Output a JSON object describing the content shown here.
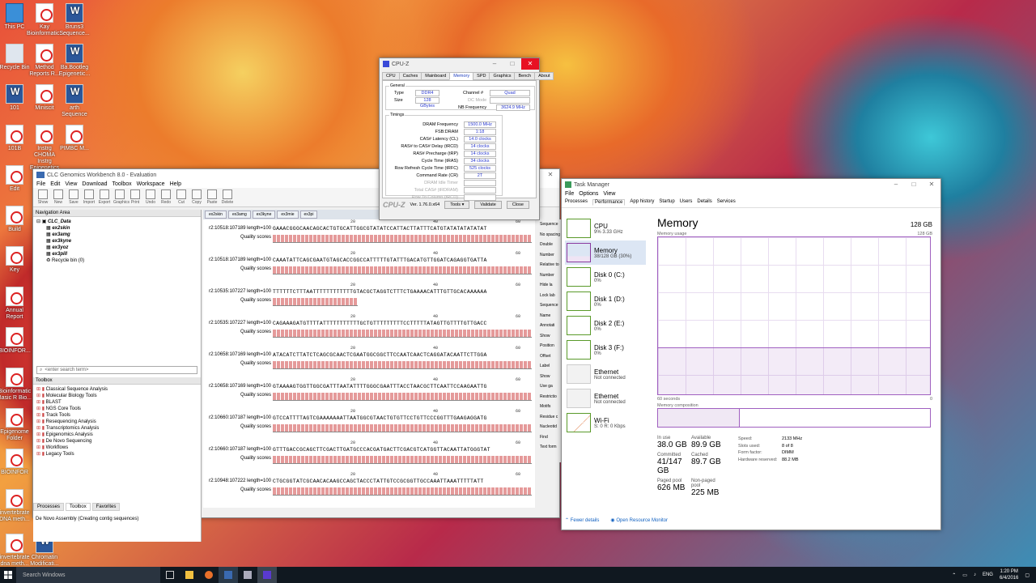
{
  "desktop": {
    "icons": [
      {
        "label": "This PC",
        "type": "pc"
      },
      {
        "label": "Kay Bioinformatic...",
        "type": "pdf"
      },
      {
        "label": "Bruns3 Sequence...",
        "type": "doc"
      },
      {
        "label": "Recycle Bin",
        "type": "bin"
      },
      {
        "label": "Method Reports R...",
        "type": "pdf"
      },
      {
        "label": "Ba.Bootleg Epigenetic...",
        "type": "doc"
      },
      {
        "label": "101",
        "type": "doc"
      },
      {
        "label": "Miniscit",
        "type": "pdf"
      },
      {
        "label": "arth Sequence",
        "type": "doc"
      },
      {
        "label": "101B",
        "type": "pdf"
      },
      {
        "label": "Instrg CHOMA Instrg Epigenetics",
        "type": "pdf"
      },
      {
        "label": "PIMBC M...",
        "type": "pdf"
      },
      {
        "label": "Edit",
        "type": "pdf"
      },
      {
        "label": "Build",
        "type": "pdf"
      },
      {
        "label": "Key",
        "type": "pdf"
      },
      {
        "label": "Annual Report",
        "type": "pdf"
      },
      {
        "label": "BIOINFOR...",
        "type": "pdf"
      },
      {
        "label": "Bioinformatic Basic R Bio...",
        "type": "pdf"
      },
      {
        "label": "Epigenome Folder",
        "type": "pdf"
      },
      {
        "label": "BIOINFOR",
        "type": "pdf"
      },
      {
        "label": "invertebrate DNA meth...",
        "type": "pdf"
      },
      {
        "label": "invertebrate dna meth...",
        "type": "pdf"
      },
      {
        "label": "Chromatin Modificati...",
        "type": "doc"
      }
    ]
  },
  "clc": {
    "title": "CLC Genomics Workbench 8.0 - Evaluation",
    "menu": [
      "File",
      "Edit",
      "View",
      "Download",
      "Toolbox",
      "Workspace",
      "Help"
    ],
    "toolbar": [
      "Show",
      "New",
      "Save",
      "Import",
      "Export",
      "Graphics",
      "Print",
      "Undo",
      "Redo",
      "Cut",
      "Copy",
      "Paste",
      "Delete"
    ],
    "nav_header": "Navigation Area",
    "tree_root": "CLC_Data",
    "tree_items": [
      "ex2skin",
      "ex3amg",
      "ex3kyne",
      "ex3yoz",
      "ex3pill"
    ],
    "tree_recycle": "Recycle bin (0)",
    "search_placeholder": "<enter search term>",
    "toolbox_header": "Toolbox",
    "toolbox_items": [
      "Classical Sequence Analysis",
      "Molecular Biology Tools",
      "BLAST",
      "NGS Core Tools",
      "Track Tools",
      "Resequencing Analysis",
      "Transcriptomics Analysis",
      "Epigenomics Analysis",
      "De Novo Sequencing",
      "Workflows",
      "Legacy Tools"
    ],
    "bottom_tabs": [
      "Processes",
      "Toolbox",
      "Favorites"
    ],
    "status": "De Novo Assembly (Creating contig sequences)",
    "tabs": [
      "ex2skin",
      "ex3amg",
      "ex3kyne",
      "ex3mie",
      "ex3pi"
    ],
    "ruler": [
      "20",
      "40",
      "60"
    ],
    "quality_label": "Quality scores",
    "reads": [
      {
        "name": "r2:10518:107189 length=100",
        "seq": "GAAACGGGCAACAGCACTGTGCATTGGCGTATATCCATTACTTATTTCATGTATATATATATAT"
      },
      {
        "name": "r2:10518:107189 length=100",
        "seq": "CAAATATTCAGCGAATGTAGCACCGGCCATTTTTGTATTTGACATGTTGGATCAGAGGTGATTA"
      },
      {
        "name": "r2:10535:107227 length=100",
        "seq": "TTTTTTCTTTAATTTTTTTTTTTTGTACGCTAGGTCTTTCTGAAAACATTTGTTGCACAAAAAA"
      },
      {
        "name": "r2:10535:107227 length=100",
        "seq": "CAGAAAGATGTTTTATTTTTTTTTTTGCTGTTTTTTTTTCCTTTTTATAGTTGTTTTGTTGACC"
      },
      {
        "name": "r2:10658:107169 length=100",
        "seq": "ATACATCTTATCTCAGCGCAACTCGAATGGCGGCTTCCAATCAACTCAGGATACAATTCTTGGA"
      },
      {
        "name": "r2:10658:107169 length=100",
        "seq": "GTAAAAGTGGTTGGCGATTTAATATTTTGGGCGAATTTACCTAACGCTTCAATTCCAAGAATTG"
      },
      {
        "name": "r2:10660:107187 length=100",
        "seq": "GTCCATTTTAGTCGAAAAAAATTAATGGCGTAACTGTGTTCCTGTTCCCGGTTTGAAGAGGATG"
      },
      {
        "name": "r2:10660:107187 length=100",
        "seq": "GTTTGACCGCAGCTTCGACTTGATGCCCACGATGACTTCGACGTCATGGTTACAATTATGGGTAT"
      },
      {
        "name": "r2:10948:107222 length=100",
        "seq": "CTGCGGTATCGCAACACAAGCCAGCTACCCTATTGTCCGCGGTTGCCAAATTAAATTTTTATT"
      }
    ],
    "side_items": [
      "Sequence",
      "No spacing",
      "Double",
      "Number",
      "Relative to",
      "Number",
      "Hide la",
      "Lock lab",
      "Sequence",
      "Name",
      "Annotati",
      "Show",
      "Position",
      "Offset",
      "Label",
      "Show",
      "Use ga",
      "Restrictio",
      "Motifs",
      "Residue c",
      "Nucleotid",
      "Find",
      "Text form"
    ]
  },
  "cpuz": {
    "title": "CPU-Z",
    "tabs": [
      "CPU",
      "Caches",
      "Mainboard",
      "Memory",
      "SPD",
      "Graphics",
      "Bench",
      "About"
    ],
    "active_tab": "Memory",
    "general_label": "General",
    "type_label": "Type",
    "type_value": "DDR4",
    "channel_label": "Channel #",
    "channel_value": "Quad",
    "size_label": "Size",
    "size_value": "128 GBytes",
    "dcmode_label": "DC Mode",
    "dcmode_value": "",
    "nb_label": "NB Frequency",
    "nb_value": "3624.9 MHz",
    "timings_label": "Timings",
    "timings": [
      {
        "k": "DRAM Frequency",
        "v": "1500.0 MHz"
      },
      {
        "k": "FSB:DRAM",
        "v": "1:18"
      },
      {
        "k": "CAS# Latency (CL)",
        "v": "14.0 clocks"
      },
      {
        "k": "RAS# to CAS# Delay (tRCD)",
        "v": "14 clocks"
      },
      {
        "k": "RAS# Precharge (tRP)",
        "v": "14 clocks"
      },
      {
        "k": "Cycle Time (tRAS)",
        "v": "34 clocks"
      },
      {
        "k": "Row Refresh Cycle Time (tRFC)",
        "v": "525 clocks"
      },
      {
        "k": "Command Rate (CR)",
        "v": "2T"
      },
      {
        "k": "DRAM Idle Timer",
        "v": ""
      },
      {
        "k": "Total CAS# (tRDRAM)",
        "v": ""
      },
      {
        "k": "Row To Column (tRCD)",
        "v": ""
      }
    ],
    "logo": "CPU-Z",
    "version": "Ver. 1.76.0.x64",
    "tools": "Tools",
    "validate": "Validate",
    "close": "Close"
  },
  "taskmgr": {
    "title": "Task Manager",
    "menu": [
      "File",
      "Options",
      "View"
    ],
    "tabs": [
      "Processes",
      "Performance",
      "App history",
      "Startup",
      "Users",
      "Details",
      "Services"
    ],
    "active_tab": "Performance",
    "items": [
      {
        "name": "CPU",
        "sub": "9% 3.33 GHz",
        "kind": "cpu"
      },
      {
        "name": "Memory",
        "sub": "38/128 GB (30%)",
        "kind": "mem"
      },
      {
        "name": "Disk 0 (C:)",
        "sub": "0%",
        "kind": "disk"
      },
      {
        "name": "Disk 1 (D:)",
        "sub": "0%",
        "kind": "disk"
      },
      {
        "name": "Disk 2 (E:)",
        "sub": "0%",
        "kind": "disk"
      },
      {
        "name": "Disk 3 (F:)",
        "sub": "0%",
        "kind": "disk"
      },
      {
        "name": "Ethernet",
        "sub": "Not connected",
        "kind": "gray"
      },
      {
        "name": "Ethernet",
        "sub": "Not connected",
        "kind": "gray"
      },
      {
        "name": "Wi-Fi",
        "sub": "S: 0 R: 0 Kbps",
        "kind": "wifi"
      }
    ],
    "heading": "Memory",
    "total": "128 GB",
    "usage_label": "Memory usage",
    "usage_max": "128 GB",
    "axis_left": "60 seconds",
    "axis_right": "0",
    "composition_label": "Memory composition",
    "in_use_fraction": 0.3,
    "stats": [
      {
        "k": "In use",
        "v": "38.0 GB"
      },
      {
        "k": "Available",
        "v": "89.9 GB"
      },
      {
        "k": "Committed",
        "v": "41/147 GB"
      },
      {
        "k": "Cached",
        "v": "89.7 GB"
      },
      {
        "k": "Paged pool",
        "v": "626 MB"
      },
      {
        "k": "Non-paged pool",
        "v": "225 MB"
      }
    ],
    "details": [
      {
        "k": "Speed:",
        "v": "2133 MHz"
      },
      {
        "k": "Slots used:",
        "v": "8 of 8"
      },
      {
        "k": "Form factor:",
        "v": "DIMM"
      },
      {
        "k": "Hardware reserved:",
        "v": "88.2 MB"
      }
    ],
    "fewer": "Fewer details",
    "resmon": "Open Resource Monitor"
  },
  "taskbar": {
    "search": "Search Windows",
    "lang": "ENG",
    "time": "1:20 PM",
    "date": "6/4/2016"
  },
  "colors": {
    "mem_accent": "#8a3aa0",
    "link": "#1060c0",
    "cpuz_value": "#2a3ad0"
  }
}
